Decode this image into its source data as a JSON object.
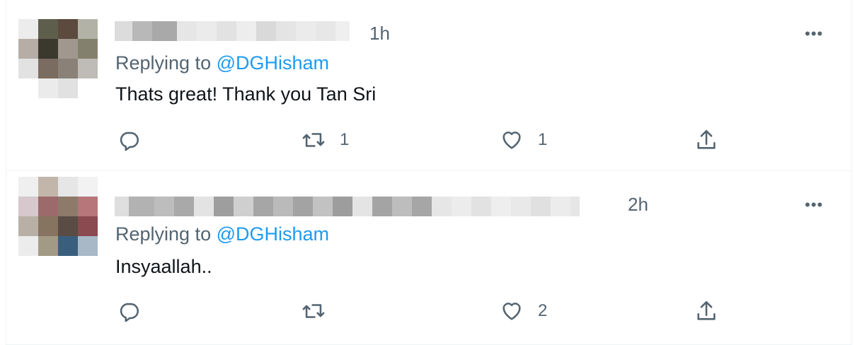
{
  "tweets": [
    {
      "time": "1h",
      "replying_prefix": "Replying to",
      "replying_handle": "@DGHisham",
      "text": "Thats great! Thank you Tan Sri",
      "more_label": "•••",
      "reply_count": "",
      "retweet_count": "1",
      "like_count": "1"
    },
    {
      "time": "2h",
      "replying_prefix": "Replying to",
      "replying_handle": "@DGHisham",
      "text": "Insyaallah..",
      "more_label": "•••",
      "reply_count": "",
      "retweet_count": "",
      "like_count": "2"
    }
  ],
  "icons": {
    "reply": "reply-icon",
    "retweet": "retweet-icon",
    "like": "heart-icon",
    "share": "share-icon",
    "more": "more-icon"
  },
  "colors": {
    "secondary_text": "#536471",
    "link": "#1d9bf0",
    "primary_text": "#0f1419",
    "divider": "#eff3f4"
  }
}
